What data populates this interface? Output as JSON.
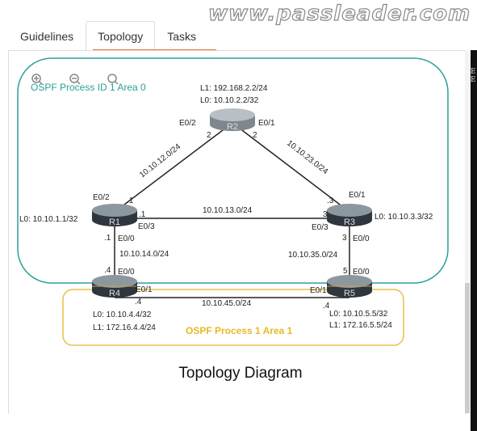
{
  "watermark": "www.passleader.com",
  "tabs": [
    {
      "label": "Guidelines"
    },
    {
      "label": "Topology",
      "active": true
    },
    {
      "label": "Tasks"
    }
  ],
  "side_panel_text": [
    "E",
    "E"
  ],
  "zoom_controls": [
    "zoom-in-icon",
    "zoom-out-icon",
    "zoom-reset-icon"
  ],
  "areas": {
    "area0": {
      "label": "OSPF Process ID 1 Area 0",
      "color": "#2aa198"
    },
    "area1": {
      "label": "OSPF Process 1 Area 1",
      "color": "#e8b923"
    }
  },
  "routers": {
    "R1": {
      "name": "R1",
      "l0": "L0: 10.10.1.1/32"
    },
    "R2": {
      "name": "R2",
      "l1": "L1: 192.168.2.2/24",
      "l0": "L0: 10.10.2.2/32"
    },
    "R3": {
      "name": "R3",
      "l0": "L0: 10.10.3.3/32"
    },
    "R4": {
      "name": "R4",
      "l0": "L0: 10.10.4.4/32",
      "l1": "L1: 172.16.4.4/24"
    },
    "R5": {
      "name": "R5",
      "l0": "L0: 10.10.5.5/32",
      "l1": "L1: 172.16.5.5/24"
    }
  },
  "links": {
    "r1r2": {
      "net": "10.10.12.0/24",
      "a_if": "E0/2",
      "a_ip": ".1",
      "b_if": "E0/2",
      "b_ip": "2"
    },
    "r2r3": {
      "net": "10.10.23.0/24",
      "a_if": "E0/1",
      "a_ip": "2",
      "b_if": "E0/1",
      "b_ip": ".3"
    },
    "r1r3": {
      "net": "10.10.13.0/24",
      "a_if": "E0/3",
      "a_ip": ".1",
      "b_if": "E0/3",
      "b_ip": "3"
    },
    "r1r4": {
      "net": "10.10.14.0/24",
      "a_if": "E0/0",
      "a_ip": ".1",
      "b_if": "E0/0",
      "b_ip": ".4"
    },
    "r3r5": {
      "net": "10.10.35.0/24",
      "a_if": "E0/0",
      "a_ip": "3",
      "b_if": "E0/0",
      "b_ip": "5"
    },
    "r4r5": {
      "net": "10.10.45.0/24",
      "a_if": "E0/1",
      "a_ip": ".4",
      "b_if": "E0/1",
      "b_ip": ".4"
    }
  },
  "caption": "Topology Diagram"
}
